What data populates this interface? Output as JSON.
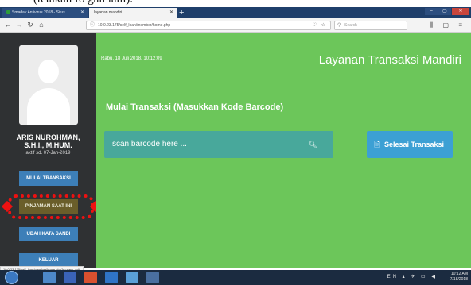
{
  "caption_fragment": "(tetakan fo gan lam).",
  "browser": {
    "tabs": [
      {
        "label": "Smadav Antivirus 2018 - Situs",
        "active": false
      },
      {
        "label": "layanan mandiri",
        "active": true
      }
    ],
    "new_tab_label": "+",
    "url": "10.0.23.175/self_loan/member/home.php",
    "search_placeholder": "Search",
    "url_actions": "··· ♡ ☆",
    "toolbar_right": "⫼ ▢ ≡"
  },
  "sidebar": {
    "user_name": "ARIS NUROHMAN,",
    "user_title": "S.H.I., M.HUM.",
    "user_status": "aktif sd. 07-Jan-2019",
    "menu": [
      {
        "label": "MULAI TRANSAKSI"
      },
      {
        "label": "PINJAMAN SAAT INI"
      },
      {
        "label": "UBAH KATA SANDI"
      },
      {
        "label": "KELUAR"
      }
    ]
  },
  "main": {
    "date": "Rabu, 18 Juli 2018, 10:12:09",
    "app_title": "Layanan Transaksi Mandiri",
    "section_title": "Mulai Transaksi (Masukkan Kode Barcode)",
    "barcode_placeholder": "scan barcode here ...",
    "finish_button": "Selesai Transaksi"
  },
  "status_bar_url": "10.0.23.175/self_loan/member/home.php?p=pass_edit",
  "taskbar": {
    "tray_language": "EN",
    "time": "10:12 AM",
    "date": "7/18/2018"
  },
  "colors": {
    "main_green": "#6cc65a",
    "sidebar_dark": "#2f3133",
    "button_blue": "#3d7fb8",
    "barcode_teal": "#48a89b",
    "finish_blue": "#3ca0d4",
    "highlight_red": "#ee1111"
  }
}
